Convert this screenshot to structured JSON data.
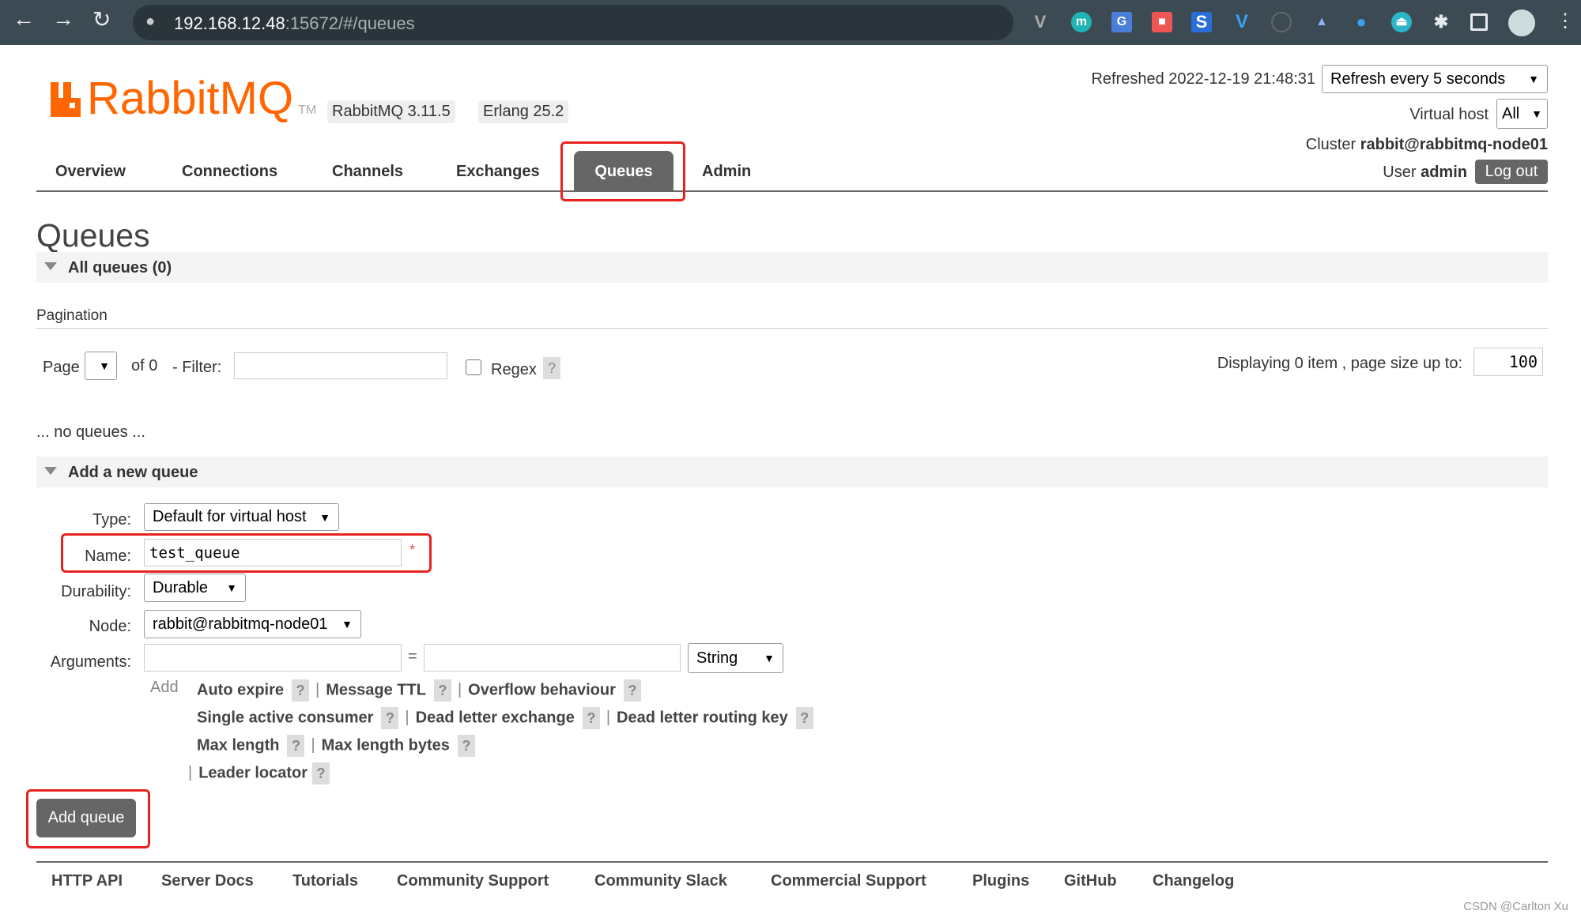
{
  "browser": {
    "url_host": "192.168.12.48",
    "url_path": ":15672/#/queues"
  },
  "header": {
    "logo_text": "RabbitMQ",
    "logo_tm": "TM",
    "version_badge": "RabbitMQ 3.11.5",
    "erlang_badge": "Erlang 25.2",
    "refreshed_label": "Refreshed 2022-12-19 21:48:31",
    "refresh_select": "Refresh every 5 seconds",
    "vhost_label": "Virtual host",
    "vhost_select": "All",
    "cluster_label": "Cluster",
    "cluster_name": "rabbit@rabbitmq-node01",
    "user_label": "User",
    "user_name": "admin",
    "logout": "Log out"
  },
  "nav": {
    "tabs": [
      "Overview",
      "Connections",
      "Channels",
      "Exchanges",
      "Queues",
      "Admin"
    ],
    "active": "Queues"
  },
  "page": {
    "title": "Queues",
    "all_queues": "All queues (0)",
    "pagination": "Pagination",
    "page_label": "Page",
    "of_label": "of 0",
    "filter_label": "- Filter:",
    "filter_value": "",
    "regex_label": "Regex",
    "help": "?",
    "displaying": "Displaying 0 item , page size up to:",
    "page_size": "100",
    "no_queues": "... no queues ..."
  },
  "add_queue": {
    "section_title": "Add a new queue",
    "type_label": "Type:",
    "type_value": "Default for virtual host",
    "name_label": "Name:",
    "name_value": "test_queue",
    "required": "*",
    "durability_label": "Durability:",
    "durability_value": "Durable",
    "node_label": "Node:",
    "node_value": "rabbit@rabbitmq-node01",
    "arguments_label": "Arguments:",
    "equals": "=",
    "arg_type": "String",
    "add_label": "Add",
    "args": [
      "Auto expire",
      "Message TTL",
      "Overflow behaviour",
      "Single active consumer",
      "Dead letter exchange",
      "Dead letter routing key",
      "Max length",
      "Max length bytes",
      "Leader locator"
    ],
    "separator": "|",
    "submit": "Add queue"
  },
  "footer": {
    "links": [
      "HTTP API",
      "Server Docs",
      "Tutorials",
      "Community Support",
      "Community Slack",
      "Commercial Support",
      "Plugins",
      "GitHub",
      "Changelog"
    ]
  },
  "watermark": "CSDN @Carlton Xu",
  "colors": {
    "brand": "#ff6600",
    "highlight": "#e8231f",
    "active_tab": "#666666"
  }
}
